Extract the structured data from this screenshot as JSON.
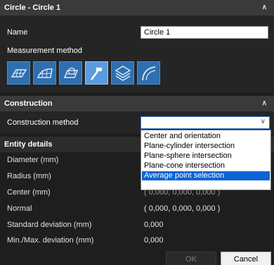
{
  "panel": {
    "title": "Circle - Circle 1",
    "name_label": "Name",
    "name_value": "Circle 1",
    "measurement_method_label": "Measurement method",
    "tools": [
      {
        "icon": "surface-probe-icon",
        "active": false
      },
      {
        "icon": "surface-mesh-icon",
        "active": false
      },
      {
        "icon": "sphere-mesh-icon",
        "active": false
      },
      {
        "icon": "probe-hammer-icon",
        "active": true
      },
      {
        "icon": "layers-icon",
        "active": false
      },
      {
        "icon": "arc-curve-icon",
        "active": false
      }
    ]
  },
  "construction": {
    "title": "Construction",
    "method_label": "Construction method",
    "method_value": "",
    "options": [
      "Center and orientation",
      "Plane-cylinder intersection",
      "Plane-sphere intersection",
      "Plane-cone intersection",
      "Average point selection"
    ],
    "selected_option": "Average point selection"
  },
  "entity_details": {
    "title": "Entity details",
    "rows": [
      {
        "label": "Diameter (mm)",
        "value": ""
      },
      {
        "label": "Radius (mm)",
        "value": ""
      },
      {
        "label": "Center (mm)",
        "value": "( 0,000, 0,000, 0,000 )"
      },
      {
        "label": "Normal",
        "value": "( 0,000, 0,000, 0,000 )"
      },
      {
        "label": "Standard deviation (mm)",
        "value": "0,000"
      },
      {
        "label": "Min./Max. deviation (mm)",
        "value": "0,000"
      }
    ]
  },
  "footer": {
    "ok_label": "OK",
    "cancel_label": "Cancel"
  },
  "colors": {
    "background": "#1e1e1e",
    "section_header": "#3a3a3a",
    "accent": "#0a64d6",
    "tool_button": "#2f6fb0"
  }
}
